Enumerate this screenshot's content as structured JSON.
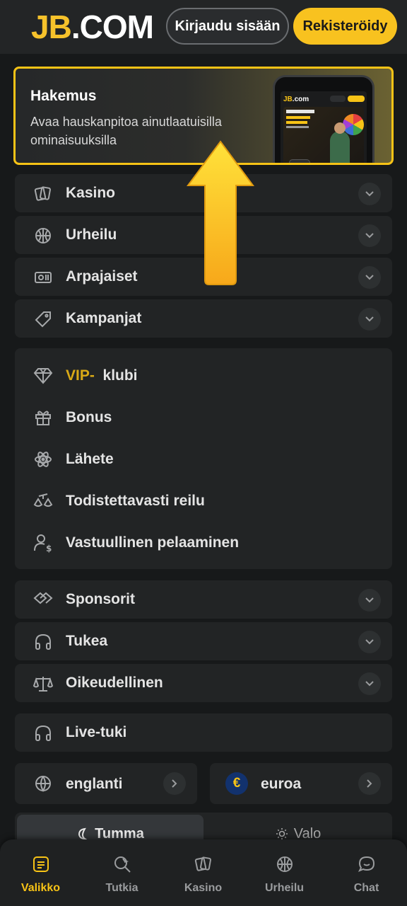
{
  "header": {
    "logo_jb": "JB",
    "logo_com": ".COM",
    "login_label": "Kirjaudu sisään",
    "register_label": "Rekisteröidy"
  },
  "promo": {
    "title": "Hakemus",
    "subtitle": "Avaa hauskanpitoa ainutlaatuisilla ominaisuuksilla",
    "phone_logo_jb": "JB",
    "phone_logo_com": ".com"
  },
  "menu_top": [
    {
      "label": "Kasino",
      "icon": "cards-icon"
    },
    {
      "label": "Urheilu",
      "icon": "basketball-icon"
    },
    {
      "label": "Arpajaiset",
      "icon": "lottery-icon"
    },
    {
      "label": "Kampanjat",
      "icon": "tag-icon"
    }
  ],
  "vip_group": {
    "vip_prefix": "VIP-",
    "vip_suffix": "klubi",
    "items": [
      {
        "label": "Bonus",
        "icon": "gift-icon"
      },
      {
        "label": "Lähete",
        "icon": "atom-icon"
      },
      {
        "label": "Todistettavasti reilu",
        "icon": "scale-icon"
      },
      {
        "label": "Vastuullinen pelaaminen",
        "icon": "user-dollar-icon"
      }
    ]
  },
  "menu_bottom": [
    {
      "label": "Sponsorit",
      "icon": "handshake-icon"
    },
    {
      "label": "Tukea",
      "icon": "headphones-icon"
    },
    {
      "label": "Oikeudellinen",
      "icon": "balance-icon"
    }
  ],
  "live_support": "Live-tuki",
  "language": "englanti",
  "currency": "euroa",
  "currency_symbol": "€",
  "theme": {
    "dark": "Tumma",
    "light": "Valo"
  },
  "bottom_nav": [
    {
      "label": "Valikko",
      "active": true
    },
    {
      "label": "Tutkia",
      "active": false
    },
    {
      "label": "Kasino",
      "active": false
    },
    {
      "label": "Urheilu",
      "active": false
    },
    {
      "label": "Chat",
      "active": false
    }
  ],
  "colors": {
    "accent": "#f7c316",
    "background": "#17191a",
    "panel": "#222425",
    "header": "#232526"
  }
}
